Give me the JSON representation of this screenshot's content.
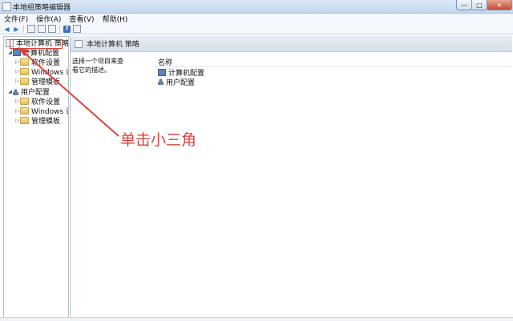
{
  "window": {
    "title": "本地组策略编辑器",
    "controls": {
      "minimize": "—",
      "maximize": "□",
      "close": "✕"
    }
  },
  "menu": {
    "items": [
      "文件(F)",
      "操作(A)",
      "查看(V)",
      "帮助(H)"
    ]
  },
  "toolbar": {
    "icons": [
      "back-arrow-icon",
      "forward-arrow-icon",
      "show-hide-tree-icon",
      "properties-icon",
      "export-icon",
      "help-icon",
      "filter-icon"
    ]
  },
  "tree": {
    "root": "本地计算机 策略",
    "computer": {
      "label": "计算机配置",
      "children": [
        "软件设置",
        "Windows 设",
        "管理模板"
      ]
    },
    "user": {
      "label": "用户配置",
      "children": [
        "软件设置",
        "Windows 设",
        "管理模板"
      ]
    }
  },
  "right": {
    "header": "本地计算机 策略",
    "description": "选择一个项目来查看它的描述。",
    "column_name": "名称",
    "items": [
      "计算机配置",
      "用户配置"
    ]
  },
  "annotation": {
    "text": "单击小三角",
    "color": "#d9443a"
  },
  "colors": {
    "accent": "#2a7bd3",
    "folder": "#e5c15c",
    "annotation": "#d9443a"
  }
}
